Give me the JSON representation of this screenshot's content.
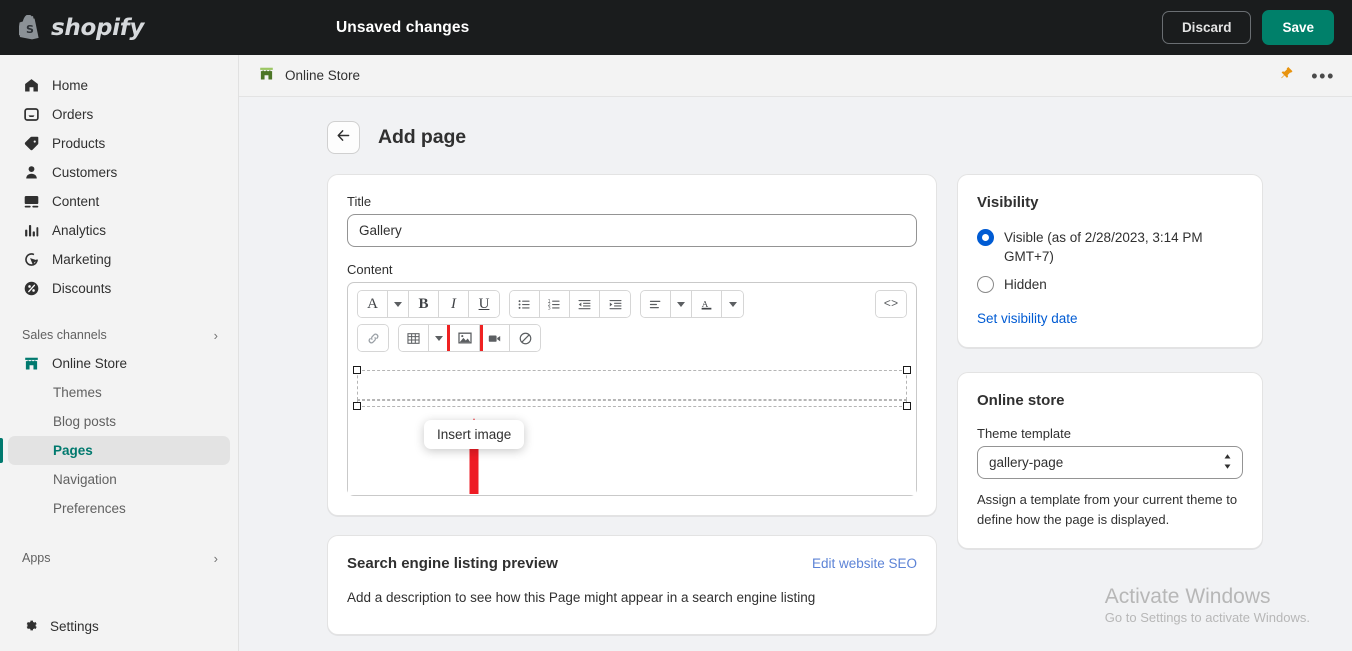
{
  "topbar": {
    "logo_text": "shopify",
    "logo_icon": "shopify-bag-icon",
    "status": "Unsaved changes",
    "discard_label": "Discard",
    "save_label": "Save",
    "save_color": "#00806a"
  },
  "sidebar": {
    "items": [
      {
        "label": "Home",
        "icon": "home-icon"
      },
      {
        "label": "Orders",
        "icon": "orders-inbox-icon"
      },
      {
        "label": "Products",
        "icon": "product-tag-icon"
      },
      {
        "label": "Customers",
        "icon": "person-icon"
      },
      {
        "label": "Content",
        "icon": "content-image-icon"
      },
      {
        "label": "Analytics",
        "icon": "bar-chart-icon"
      },
      {
        "label": "Marketing",
        "icon": "target-cursor-icon"
      },
      {
        "label": "Discounts",
        "icon": "discount-percent-icon"
      }
    ],
    "sales_channels_label": "Sales channels",
    "online_store": {
      "label": "Online Store",
      "icon": "storefront-icon"
    },
    "online_store_children": [
      {
        "label": "Themes",
        "active": false
      },
      {
        "label": "Blog posts",
        "active": false
      },
      {
        "label": "Pages",
        "active": true
      },
      {
        "label": "Navigation",
        "active": false
      },
      {
        "label": "Preferences",
        "active": false
      }
    ],
    "apps_label": "Apps",
    "settings_label": "Settings",
    "active_color": "#00796e"
  },
  "context_bar": {
    "store_name": "Online Store",
    "store_icon": "storefront-icon",
    "pin_icon": "pin-icon",
    "more_icon": "ellipsis-icon"
  },
  "page": {
    "back_icon": "arrow-left-icon",
    "title": "Add page"
  },
  "details_card": {
    "title_label": "Title",
    "title_value": "Gallery",
    "title_placeholder": "",
    "content_label": "Content"
  },
  "editor_toolbar": {
    "row1": [
      {
        "name": "font-format-button",
        "glyph": "A",
        "type": "serif"
      },
      {
        "name": "font-format-caret",
        "glyph": "",
        "type": "caret"
      },
      {
        "name": "bold-button",
        "glyph": "B",
        "type": "bold"
      },
      {
        "name": "italic-button",
        "glyph": "I",
        "type": "italic"
      },
      {
        "name": "underline-button",
        "glyph": "U",
        "type": "underline"
      },
      {
        "name": "bulleted-list-button",
        "glyph": "",
        "type": "ul"
      },
      {
        "name": "numbered-list-button",
        "glyph": "",
        "type": "ol"
      },
      {
        "name": "outdent-button",
        "glyph": "",
        "type": "outdent"
      },
      {
        "name": "indent-button",
        "glyph": "",
        "type": "indent"
      },
      {
        "name": "align-button",
        "glyph": "",
        "type": "align"
      },
      {
        "name": "align-caret",
        "glyph": "",
        "type": "caret"
      },
      {
        "name": "text-color-button",
        "glyph": "A",
        "type": "color"
      },
      {
        "name": "text-color-caret",
        "glyph": "",
        "type": "caret"
      },
      {
        "name": "show-html-button",
        "glyph": "<>",
        "type": "code"
      }
    ],
    "row2": [
      {
        "name": "insert-link-button",
        "type": "link"
      },
      {
        "name": "insert-table-button",
        "type": "table"
      },
      {
        "name": "insert-table-caret",
        "type": "caret"
      },
      {
        "name": "insert-image-button",
        "type": "image",
        "highlighted": true
      },
      {
        "name": "insert-video-button",
        "type": "video"
      },
      {
        "name": "clear-formatting-button",
        "type": "clear"
      }
    ],
    "tooltip": "Insert image",
    "highlight_color": "#ef2222",
    "arrow_color": "#ee1c25"
  },
  "visibility_card": {
    "title": "Visibility",
    "options": [
      {
        "label": "Visible (as of 2/28/2023, 3:14 PM GMT+7)",
        "selected": true
      },
      {
        "label": "Hidden",
        "selected": false
      }
    ],
    "set_date_link": "Set visibility date",
    "accent_color": "#005bd3"
  },
  "online_store_card": {
    "title": "Online store",
    "template_label": "Theme template",
    "template_value": "gallery-page",
    "help_text": "Assign a template from your current theme to define how the page is displayed."
  },
  "seo_card": {
    "title": "Search engine listing preview",
    "edit_link": "Edit website SEO",
    "description": "Add a description to see how this Page might appear in a search engine listing"
  },
  "watermark": {
    "line1": "Activate Windows",
    "line2": "Go to Settings to activate Windows."
  }
}
